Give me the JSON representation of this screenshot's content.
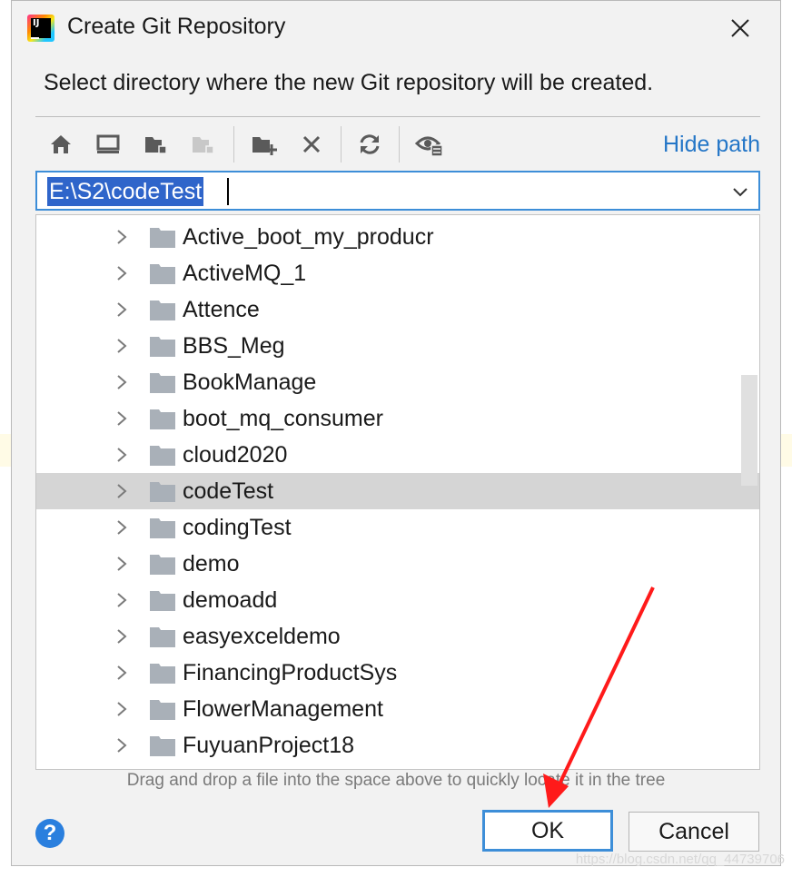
{
  "window": {
    "title": "Create Git Repository",
    "instruction": "Select directory where the new Git repository will be created."
  },
  "toolbar": {
    "buttons": [
      {
        "icon": "home-icon",
        "enabled": true
      },
      {
        "icon": "desktop-icon",
        "enabled": true
      },
      {
        "icon": "project-folder-icon",
        "enabled": true
      },
      {
        "icon": "module-folder-icon",
        "enabled": false
      },
      {
        "icon": "new-folder-icon",
        "enabled": true
      },
      {
        "icon": "delete-icon",
        "enabled": true
      },
      {
        "icon": "refresh-icon",
        "enabled": true
      },
      {
        "icon": "show-hidden-icon",
        "enabled": true
      }
    ],
    "hide_path_label": "Hide path"
  },
  "path": {
    "value": "E:\\S2\\codeTest"
  },
  "tree": {
    "items": [
      {
        "label": "Active_boot_my_producr",
        "selected": false
      },
      {
        "label": "ActiveMQ_1",
        "selected": false
      },
      {
        "label": "Attence",
        "selected": false
      },
      {
        "label": "BBS_Meg",
        "selected": false
      },
      {
        "label": "BookManage",
        "selected": false
      },
      {
        "label": "boot_mq_consumer",
        "selected": false
      },
      {
        "label": "cloud2020",
        "selected": false
      },
      {
        "label": "codeTest",
        "selected": true
      },
      {
        "label": "codingTest",
        "selected": false
      },
      {
        "label": "demo",
        "selected": false
      },
      {
        "label": "demoadd",
        "selected": false
      },
      {
        "label": "easyexceldemo",
        "selected": false
      },
      {
        "label": "FinancingProductSys",
        "selected": false
      },
      {
        "label": "FlowerManagement",
        "selected": false
      },
      {
        "label": "FuyuanProject18",
        "selected": false
      }
    ]
  },
  "hint": "Drag and drop a file into the space above to quickly locate it in the tree",
  "buttons": {
    "help": "?",
    "ok": "OK",
    "cancel": "Cancel"
  },
  "colors": {
    "accent": "#3d8ed8",
    "link": "#2476c7",
    "selection": "#2f65ca",
    "row_selected": "#d5d5d5",
    "annotation_arrow": "#ff1a1a"
  },
  "watermark": "https://blog.csdn.net/qq_44739706"
}
